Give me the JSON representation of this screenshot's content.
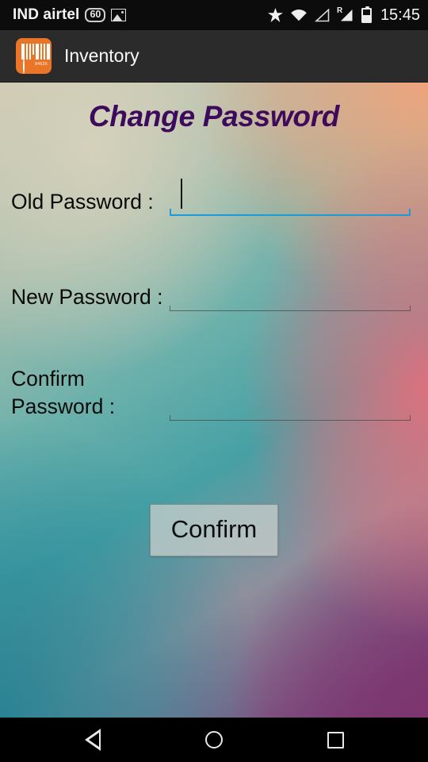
{
  "status_bar": {
    "carrier": "IND airtel",
    "data_badge": "60",
    "clock": "15:45",
    "icons": {
      "image": "image-icon",
      "star": "star-icon",
      "wifi": "wifi-icon",
      "signal_empty": "signal-empty-icon",
      "signal_roaming": "signal-roaming-icon",
      "roaming_letter": "R",
      "battery": "battery-icon"
    }
  },
  "action_bar": {
    "app_icon": "barcode-scanner-icon",
    "app_icon_digits": "84526",
    "title": "Inventory"
  },
  "screen": {
    "title": "Change Password",
    "title_color": "#3e0b5c",
    "accent_focus_color": "#1e9ad6"
  },
  "form": {
    "fields": [
      {
        "label": "Old Password :",
        "value": "",
        "placeholder": "",
        "focused": true,
        "name": "old-password"
      },
      {
        "label": "New Password :",
        "value": "",
        "placeholder": "",
        "focused": false,
        "name": "new-password"
      },
      {
        "label": "Confirm Password :",
        "value": "",
        "placeholder": "",
        "focused": false,
        "name": "confirm-password"
      }
    ],
    "submit_label": "Confirm"
  },
  "nav_bar": {
    "back": "back-triangle-icon",
    "home": "home-circle-icon",
    "recents": "recents-square-icon"
  }
}
